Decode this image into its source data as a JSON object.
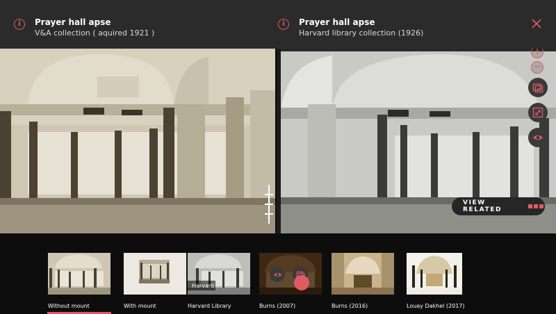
{
  "left_panel": {
    "title": "Prayer hall apse",
    "subtitle": "V&A collection ( aquired 1921 )"
  },
  "right_panel": {
    "title": "Prayer hall apse",
    "subtitle": "Harvard library collection (1926)"
  },
  "icons": {
    "info": "info-circle-icon",
    "close": "close-x-icon",
    "zoom_in": "plus-circle-icon",
    "zoom_out": "minus-circle-icon",
    "compare": "image-compare-icon",
    "expand": "expand-arrows-icon",
    "visibility": "eye-icon"
  },
  "zoom": {
    "in_label": "+",
    "out_label": "−"
  },
  "view_related": {
    "label": "VIEW RELATED"
  },
  "thumbnails": [
    {
      "caption": "Without mount"
    },
    {
      "caption": "With mount"
    },
    {
      "caption": "Harvard Library",
      "overlay": "Harvard"
    },
    {
      "caption": "Burns (2007)"
    },
    {
      "caption": "Burns (2016)"
    },
    {
      "caption": "Louay Dakhel (2017)"
    }
  ],
  "colors": {
    "accent": "#e05a64",
    "topbar": "#2b2b2b",
    "background": "#0d0d0d"
  }
}
